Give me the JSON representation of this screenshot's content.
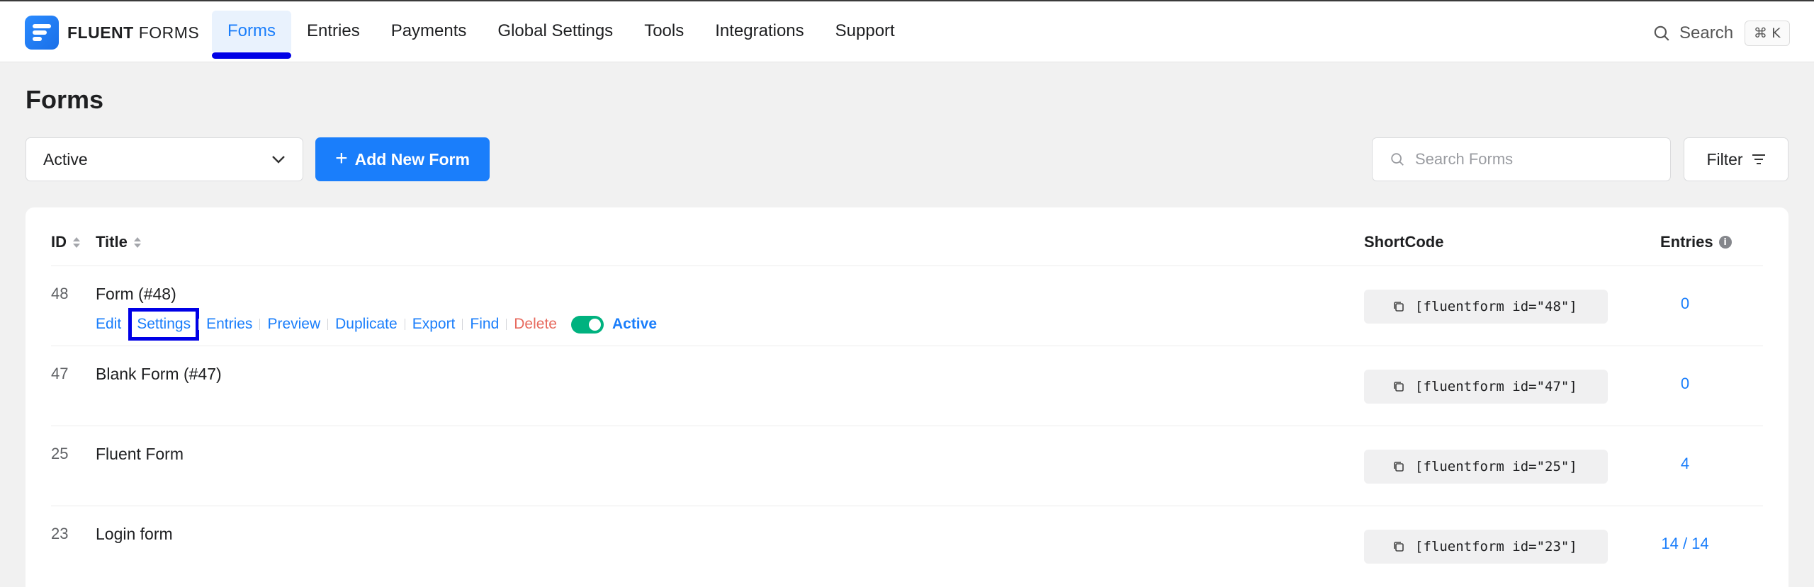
{
  "brand": {
    "name_bold": "FLUENT",
    "name_light": "FORMS"
  },
  "nav": {
    "items": [
      {
        "label": "Forms",
        "active": true
      },
      {
        "label": "Entries"
      },
      {
        "label": "Payments"
      },
      {
        "label": "Global Settings"
      },
      {
        "label": "Tools"
      },
      {
        "label": "Integrations"
      },
      {
        "label": "Support"
      }
    ]
  },
  "header_search": {
    "label": "Search",
    "shortcut": "⌘ K"
  },
  "page": {
    "title": "Forms"
  },
  "toolbar": {
    "status_select": "Active",
    "add_button": "Add New Form",
    "search_placeholder": "Search Forms",
    "filter_button": "Filter"
  },
  "table": {
    "columns": {
      "id": "ID",
      "title": "Title",
      "shortcode": "ShortCode",
      "entries": "Entries"
    },
    "row_actions": {
      "edit": "Edit",
      "settings": "Settings",
      "entries": "Entries",
      "preview": "Preview",
      "duplicate": "Duplicate",
      "export": "Export",
      "find": "Find",
      "delete": "Delete",
      "status": "Active"
    },
    "rows": [
      {
        "id": "48",
        "title": "Form (#48)",
        "shortcode": "[fluentform id=\"48\"]",
        "entries": "0"
      },
      {
        "id": "47",
        "title": "Blank Form (#47)",
        "shortcode": "[fluentform id=\"47\"]",
        "entries": "0"
      },
      {
        "id": "25",
        "title": "Fluent Form",
        "shortcode": "[fluentform id=\"25\"]",
        "entries": "4"
      },
      {
        "id": "23",
        "title": "Login form",
        "shortcode": "[fluentform id=\"23\"]",
        "entries": "14 / 14"
      }
    ]
  },
  "colors": {
    "accent": "#1a7efb",
    "highlight": "#0000e6",
    "toggle_on": "#00b27f",
    "danger": "#e76a5e"
  }
}
